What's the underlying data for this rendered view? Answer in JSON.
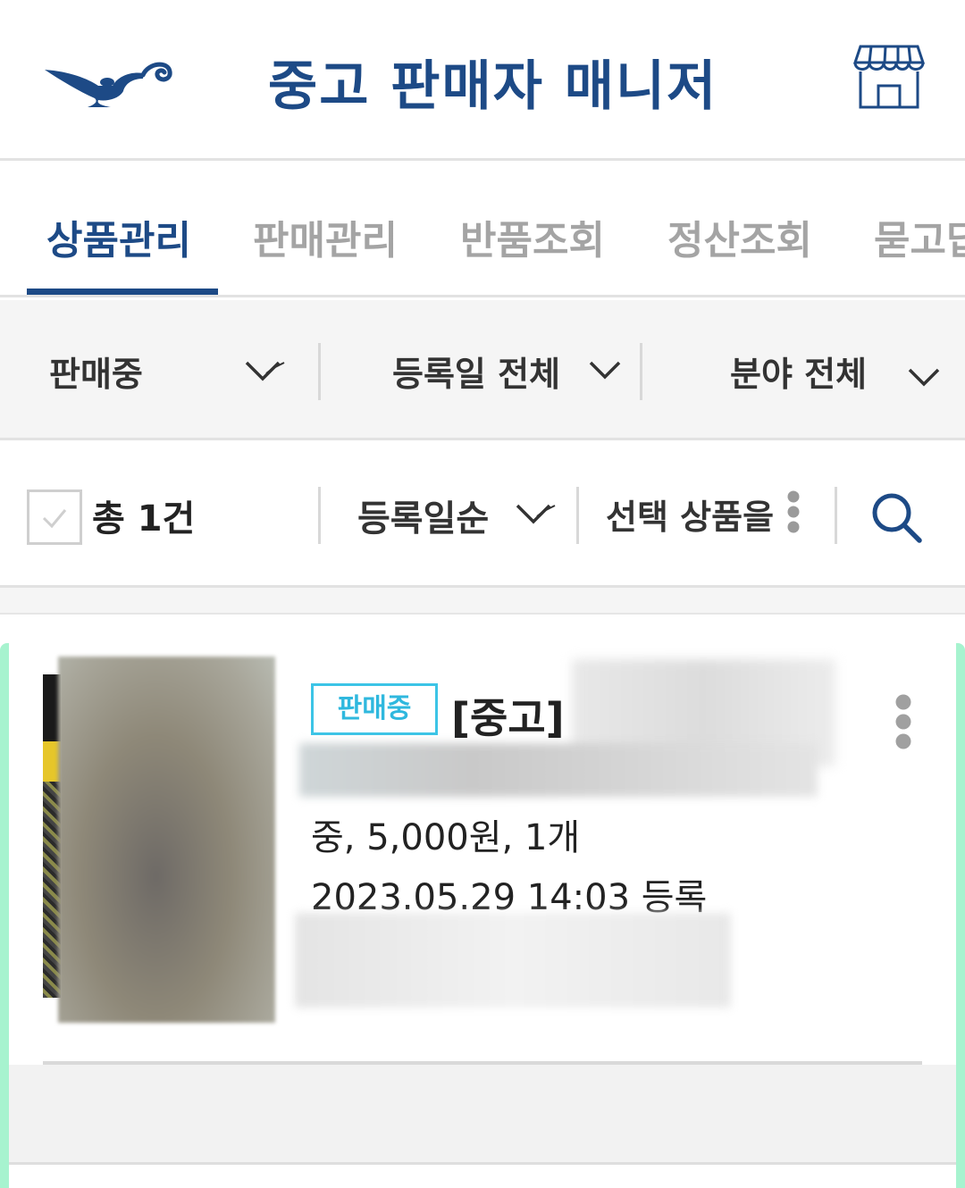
{
  "header": {
    "title": "중고 판매자 매니저",
    "logo_icon": "magic-lamp-icon",
    "store_icon": "store-icon"
  },
  "tabs": [
    {
      "label": "상품관리",
      "active": true
    },
    {
      "label": "판매관리",
      "active": false
    },
    {
      "label": "반품조회",
      "active": false
    },
    {
      "label": "정산조회",
      "active": false
    },
    {
      "label": "묻고답",
      "active": false
    }
  ],
  "filters": {
    "status": "판매중",
    "date": "등록일 전체",
    "category": "분야 전체"
  },
  "toolbar": {
    "total": "총 1건",
    "sort": "등록일순",
    "selected_action": "선택 상품을"
  },
  "item": {
    "badge": "판매중",
    "title": "[중고]",
    "info": "중, 5,000원, 1개",
    "date": "2023.05.29 14:03 등록"
  },
  "colors": {
    "brand": "#1d4a86",
    "badge": "#2fb8de",
    "card_edge": "#a7f3cf",
    "inactive_tab": "#a4a4a4"
  }
}
